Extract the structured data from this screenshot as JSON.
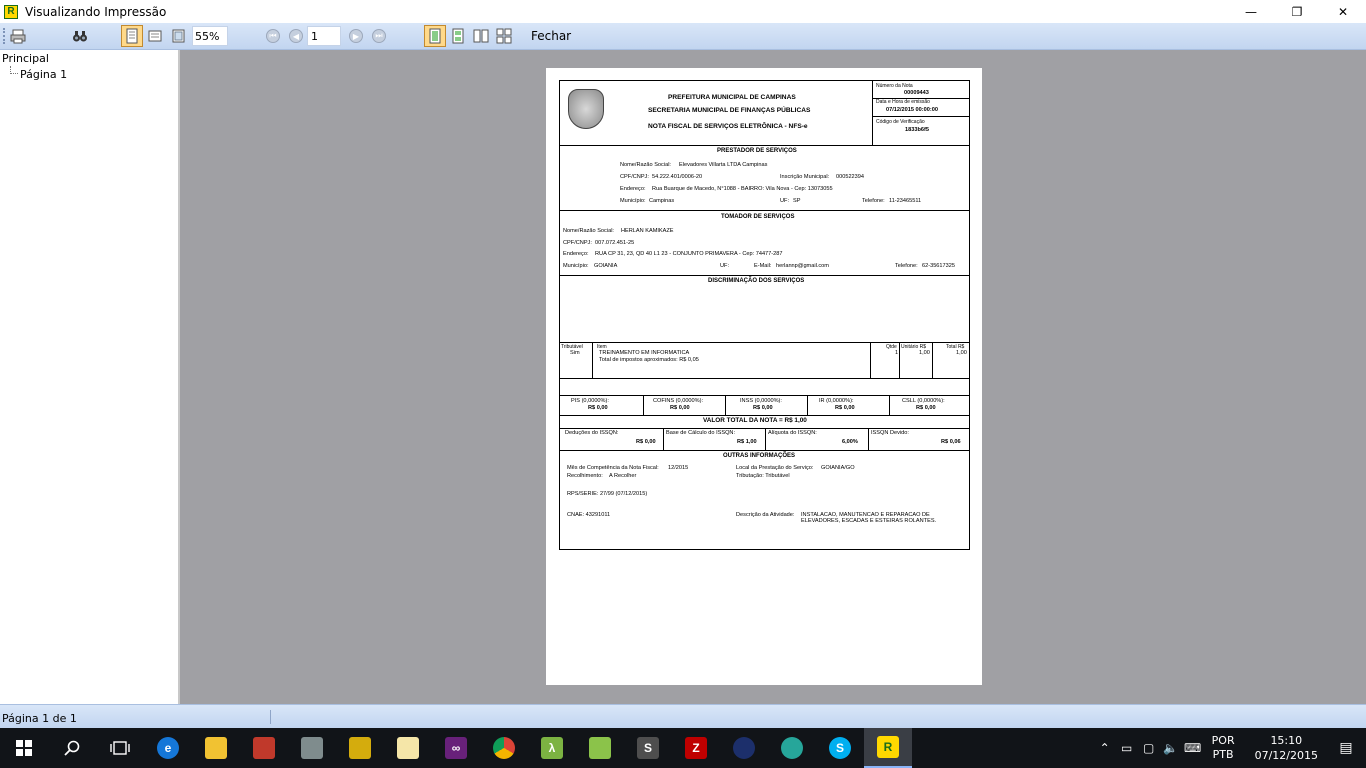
{
  "window": {
    "title": "Visualizando Impressão",
    "minimize": "—",
    "maximize": "❐",
    "close": "✕"
  },
  "toolbar": {
    "zoom": "55%",
    "page_number": "1",
    "close_label": "Fechar"
  },
  "tree": {
    "root": "Principal",
    "child": "Página 1"
  },
  "status": {
    "text": "Página 1 de 1"
  },
  "taskbar": {
    "language_1": "POR",
    "language_2": "PTB",
    "time": "15:10",
    "date": "07/12/2015"
  },
  "invoice": {
    "header_line1": "PREFEITURA MUNICIPAL DE CAMPINAS",
    "header_line2": "SECRETARIA MUNICIPAL DE FINANÇAS PÚBLICAS",
    "header_line3": "NOTA FISCAL DE SERVIÇOS ELETRÔNICA - NFS-e",
    "numero_label": "Número da Nota",
    "numero_value": "00009443",
    "data_label": "Data e Hora de emissão",
    "data_value": "07/12/2015 00:00:00",
    "codigo_label": "Código de Verificação",
    "codigo_value": "1833b6f5",
    "prestador_title": "PRESTADOR DE SERVIÇOS",
    "p_nome_label": "Nome/Razão Social:",
    "p_nome_value": "Elevadores Villarta LTDA  Campinas",
    "p_cnpj_label": "CPF/CNPJ:",
    "p_cnpj_value": "54.222.401/0006-20",
    "p_im_label": "Inscrição Municipal:",
    "p_im_value": "000522394",
    "p_end_label": "Endereço:",
    "p_end_value": "Rua Buarque de Macedo, N°1088 - BAIRRO: Vila Nova - Cep: 13073055",
    "p_mun_label": "Município:",
    "p_mun_value": "Campinas",
    "p_uf_label": "UF:",
    "p_uf_value": "SP",
    "p_tel_label": "Telefone:",
    "p_tel_value": "11-23465511",
    "tomador_title": "TOMADOR DE SERVIÇOS",
    "t_nome_label": "Nome/Razão Social:",
    "t_nome_value": "HERLAN KAMIKAZE",
    "t_cpf_label": "CPF/CNPJ:",
    "t_cpf_value": "007.072.451-25",
    "t_end_label": "Endereço:",
    "t_end_value": "RUA CP 31, 23, QD 40 L1 23 - CONJUNTO PRIMAVERA - Cep: 74477-287",
    "t_mun_label": "Município:",
    "t_mun_value": "GOIANIA",
    "t_uf_label": "UF:",
    "t_email_label": "E-Mail:",
    "t_email_value": "herlannp@gmail.com",
    "t_tel_label": "Telefone:",
    "t_tel_value": "62-35617325",
    "disc_title": "DISCRIMINAÇÃO DOS SERVIÇOS",
    "col_tributavel": "Tributável",
    "col_tributavel_val": "Sim",
    "col_item": "Item",
    "item_line1": "TREINAMENTO EM INFORMATICA",
    "item_line2": "Total de impostos aproximados: R$ 0,05",
    "col_qtde": "Qtde",
    "qtde_val": "1",
    "col_unit": "Unitário R$",
    "unit_val": "1,00",
    "col_total": "Total R$",
    "total_val": "1,00",
    "pis_label": "PIS (0,0000%):",
    "pis_value": "R$ 0,00",
    "cofins_label": "COFINS (0,0000%):",
    "cofins_value": "R$ 0,00",
    "inss_label": "INSS (0,0000%):",
    "inss_value": "R$ 0,00",
    "ir_label": "IR (0,0000%):",
    "ir_value": "R$ 0,00",
    "csll_label": "CSLL (0,0000%):",
    "csll_value": "R$ 0,00",
    "valor_total": "VALOR TOTAL DA NOTA = R$   1,00",
    "ded_label": "Deduções do ISSQN:",
    "ded_value": "R$ 0,00",
    "base_label": "Base de Cálculo do ISSQN:",
    "base_value": "R$ 1,00",
    "aliq_label": "Alíquota do ISSQN:",
    "aliq_value": "6,00%",
    "iss_label": "ISSQN Devido:",
    "iss_value": "R$ 0,06",
    "outras_title": "OUTRAS INFORMAÇÕES",
    "mes_label": "Mês de Competência da Nota Fiscal:",
    "mes_value": "12/2015",
    "local_label": "Local da Prestação do Serviço:",
    "local_value": "GOIANIA/GO",
    "recol_label": "Recolhimento:",
    "recol_value": "A Recolher",
    "trib_label": "Tributação: Tributável",
    "rps_label": "RPS/SERIE: 27/99 (07/12/2015)",
    "cnae_label": "CNAE: 43291011",
    "desc_label": "Descrição da Atividade:",
    "desc_value1": "INSTALACAO, MANUTENCAO E REPARACAO DE",
    "desc_value2": "ELEVADORES, ESCADAS E ESTEIRAS ROLANTES."
  }
}
